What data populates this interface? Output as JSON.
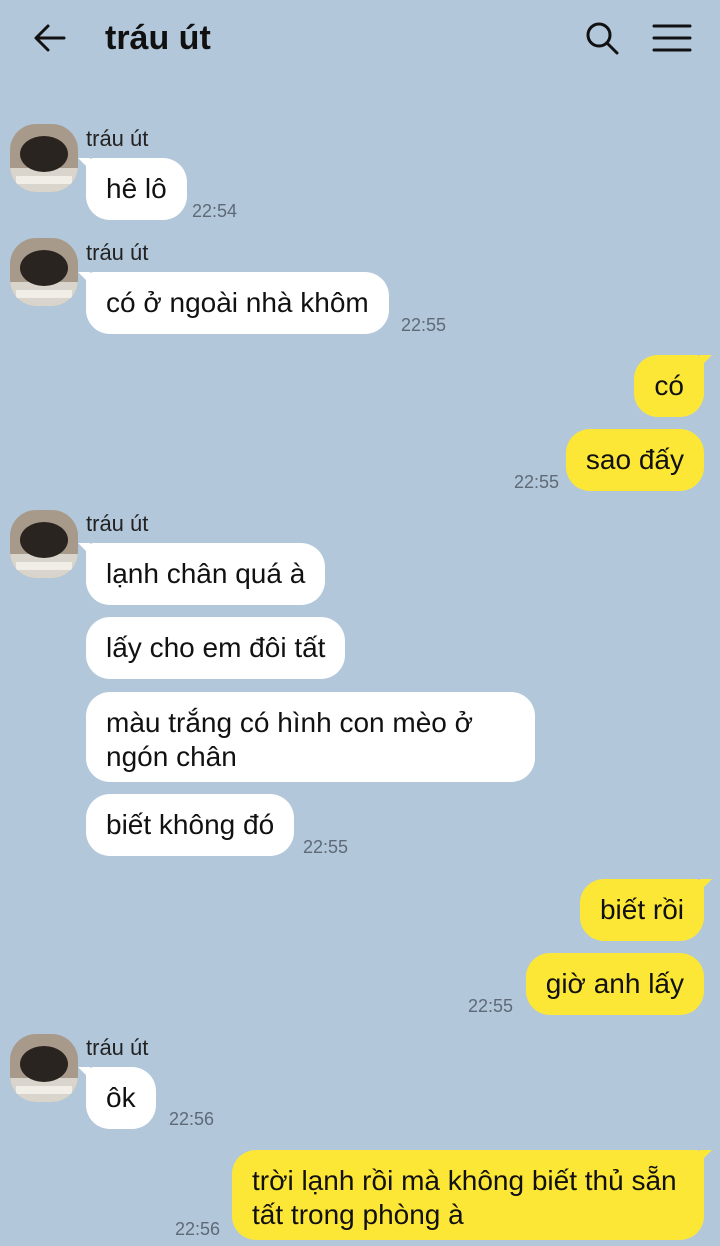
{
  "header": {
    "title": "tráu út"
  },
  "messages": [
    {
      "sender": "tráu út",
      "text": "hê lô",
      "time": "22:54"
    },
    {
      "sender": "tráu út",
      "text": "có ở ngoài nhà khôm",
      "time": "22:55"
    },
    {
      "text": "có"
    },
    {
      "text": "sao đấy",
      "time": "22:55"
    },
    {
      "sender": "tráu út",
      "text": "lạnh chân quá à"
    },
    {
      "text": "lấy cho em đôi tất"
    },
    {
      "text": "màu trắng có hình con mèo ở ngón chân"
    },
    {
      "text": "biết không đó",
      "time": "22:55"
    },
    {
      "text": "biết rồi"
    },
    {
      "text": "giờ anh lấy",
      "time": "22:55"
    },
    {
      "sender": "tráu út",
      "text": "ôk",
      "time": "22:56"
    },
    {
      "text": "trời lạnh rồi mà không biết thủ sẵn tất trong phòng à",
      "time": "22:56"
    }
  ],
  "colors": {
    "background": "#b3c7da",
    "incoming": "#ffffff",
    "outgoing": "#fde736"
  },
  "icons": [
    "back-arrow-icon",
    "search-icon",
    "menu-icon",
    "avatar-photo"
  ]
}
